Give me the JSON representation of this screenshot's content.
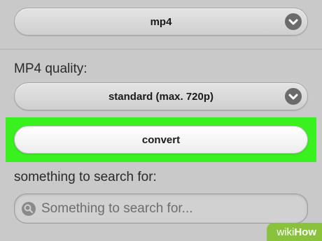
{
  "format_select": {
    "value": "mp4",
    "icon": "chevron-down-icon"
  },
  "quality": {
    "label": "MP4 quality:",
    "value": "standard (max. 720p)",
    "icon": "chevron-down-icon"
  },
  "convert": {
    "label": "convert",
    "highlight_color": "#39f11e"
  },
  "search": {
    "label": "something to search for:",
    "placeholder": "Something to search for...",
    "icon": "search-icon"
  },
  "watermark": {
    "part1": "wiki",
    "part2": "How",
    "color": "#8ac23e"
  }
}
